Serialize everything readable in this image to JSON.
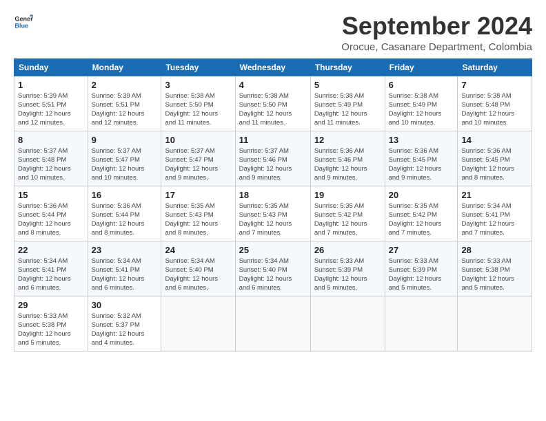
{
  "header": {
    "logo_line1": "General",
    "logo_line2": "Blue",
    "month": "September 2024",
    "location": "Orocue, Casanare Department, Colombia"
  },
  "days_of_week": [
    "Sunday",
    "Monday",
    "Tuesday",
    "Wednesday",
    "Thursday",
    "Friday",
    "Saturday"
  ],
  "weeks": [
    [
      {
        "day": "1",
        "info": "Sunrise: 5:39 AM\nSunset: 5:51 PM\nDaylight: 12 hours\nand 12 minutes."
      },
      {
        "day": "2",
        "info": "Sunrise: 5:39 AM\nSunset: 5:51 PM\nDaylight: 12 hours\nand 12 minutes."
      },
      {
        "day": "3",
        "info": "Sunrise: 5:38 AM\nSunset: 5:50 PM\nDaylight: 12 hours\nand 11 minutes."
      },
      {
        "day": "4",
        "info": "Sunrise: 5:38 AM\nSunset: 5:50 PM\nDaylight: 12 hours\nand 11 minutes."
      },
      {
        "day": "5",
        "info": "Sunrise: 5:38 AM\nSunset: 5:49 PM\nDaylight: 12 hours\nand 11 minutes."
      },
      {
        "day": "6",
        "info": "Sunrise: 5:38 AM\nSunset: 5:49 PM\nDaylight: 12 hours\nand 10 minutes."
      },
      {
        "day": "7",
        "info": "Sunrise: 5:38 AM\nSunset: 5:48 PM\nDaylight: 12 hours\nand 10 minutes."
      }
    ],
    [
      {
        "day": "8",
        "info": "Sunrise: 5:37 AM\nSunset: 5:48 PM\nDaylight: 12 hours\nand 10 minutes."
      },
      {
        "day": "9",
        "info": "Sunrise: 5:37 AM\nSunset: 5:47 PM\nDaylight: 12 hours\nand 10 minutes."
      },
      {
        "day": "10",
        "info": "Sunrise: 5:37 AM\nSunset: 5:47 PM\nDaylight: 12 hours\nand 9 minutes."
      },
      {
        "day": "11",
        "info": "Sunrise: 5:37 AM\nSunset: 5:46 PM\nDaylight: 12 hours\nand 9 minutes."
      },
      {
        "day": "12",
        "info": "Sunrise: 5:36 AM\nSunset: 5:46 PM\nDaylight: 12 hours\nand 9 minutes."
      },
      {
        "day": "13",
        "info": "Sunrise: 5:36 AM\nSunset: 5:45 PM\nDaylight: 12 hours\nand 9 minutes."
      },
      {
        "day": "14",
        "info": "Sunrise: 5:36 AM\nSunset: 5:45 PM\nDaylight: 12 hours\nand 8 minutes."
      }
    ],
    [
      {
        "day": "15",
        "info": "Sunrise: 5:36 AM\nSunset: 5:44 PM\nDaylight: 12 hours\nand 8 minutes."
      },
      {
        "day": "16",
        "info": "Sunrise: 5:36 AM\nSunset: 5:44 PM\nDaylight: 12 hours\nand 8 minutes."
      },
      {
        "day": "17",
        "info": "Sunrise: 5:35 AM\nSunset: 5:43 PM\nDaylight: 12 hours\nand 8 minutes."
      },
      {
        "day": "18",
        "info": "Sunrise: 5:35 AM\nSunset: 5:43 PM\nDaylight: 12 hours\nand 7 minutes."
      },
      {
        "day": "19",
        "info": "Sunrise: 5:35 AM\nSunset: 5:42 PM\nDaylight: 12 hours\nand 7 minutes."
      },
      {
        "day": "20",
        "info": "Sunrise: 5:35 AM\nSunset: 5:42 PM\nDaylight: 12 hours\nand 7 minutes."
      },
      {
        "day": "21",
        "info": "Sunrise: 5:34 AM\nSunset: 5:41 PM\nDaylight: 12 hours\nand 7 minutes."
      }
    ],
    [
      {
        "day": "22",
        "info": "Sunrise: 5:34 AM\nSunset: 5:41 PM\nDaylight: 12 hours\nand 6 minutes."
      },
      {
        "day": "23",
        "info": "Sunrise: 5:34 AM\nSunset: 5:41 PM\nDaylight: 12 hours\nand 6 minutes."
      },
      {
        "day": "24",
        "info": "Sunrise: 5:34 AM\nSunset: 5:40 PM\nDaylight: 12 hours\nand 6 minutes."
      },
      {
        "day": "25",
        "info": "Sunrise: 5:34 AM\nSunset: 5:40 PM\nDaylight: 12 hours\nand 6 minutes."
      },
      {
        "day": "26",
        "info": "Sunrise: 5:33 AM\nSunset: 5:39 PM\nDaylight: 12 hours\nand 5 minutes."
      },
      {
        "day": "27",
        "info": "Sunrise: 5:33 AM\nSunset: 5:39 PM\nDaylight: 12 hours\nand 5 minutes."
      },
      {
        "day": "28",
        "info": "Sunrise: 5:33 AM\nSunset: 5:38 PM\nDaylight: 12 hours\nand 5 minutes."
      }
    ],
    [
      {
        "day": "29",
        "info": "Sunrise: 5:33 AM\nSunset: 5:38 PM\nDaylight: 12 hours\nand 5 minutes."
      },
      {
        "day": "30",
        "info": "Sunrise: 5:32 AM\nSunset: 5:37 PM\nDaylight: 12 hours\nand 4 minutes."
      },
      {
        "day": "",
        "info": ""
      },
      {
        "day": "",
        "info": ""
      },
      {
        "day": "",
        "info": ""
      },
      {
        "day": "",
        "info": ""
      },
      {
        "day": "",
        "info": ""
      }
    ]
  ]
}
